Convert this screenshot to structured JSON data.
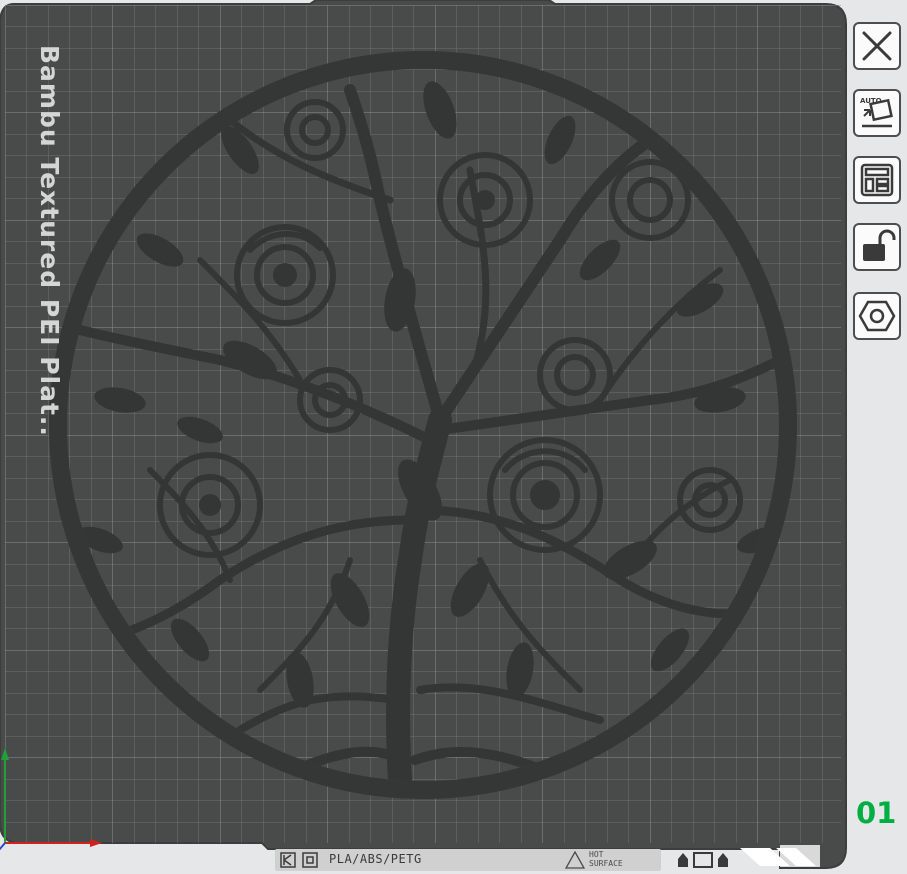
{
  "plate": {
    "name": "Bambu Textured PEI Plat...",
    "number": "01",
    "materials": "PLA/ABS/PETG",
    "hot_surface_line1": "HOT",
    "hot_surface_line2": "SURFACE",
    "model_name": "tree-of-roses-circle-model"
  },
  "toolbar": {
    "buttons": [
      {
        "name": "close",
        "icon": "close-icon"
      },
      {
        "name": "auto-orient",
        "icon": "auto-orient-icon",
        "icon_text": "AUTO"
      },
      {
        "name": "arrange",
        "icon": "arrange-icon"
      },
      {
        "name": "lock",
        "icon": "unlock-icon"
      },
      {
        "name": "plate-settings",
        "icon": "hex-nut-icon"
      }
    ]
  },
  "colors": {
    "plate_surface": "#464848",
    "grid_line": "#6a6c6e",
    "model": "#333535",
    "background": "#e6e7e8",
    "accent_green": "#00ae42",
    "axis_x": "#d12020",
    "axis_y": "#1fa038"
  }
}
